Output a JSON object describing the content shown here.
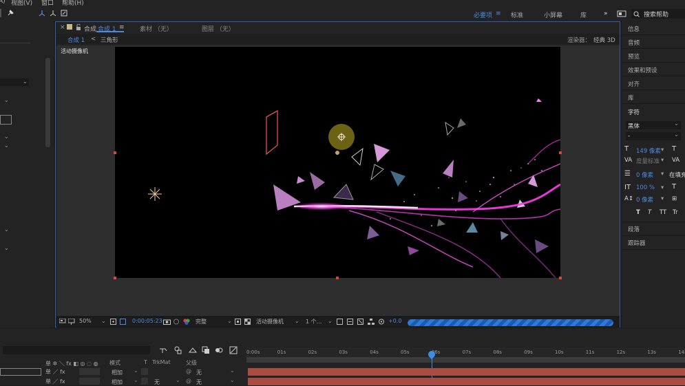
{
  "menubar": {
    "items": [
      "A)",
      "视图(V)",
      "窗口",
      "帮助(H)"
    ]
  },
  "workspaces": {
    "items": [
      "必要项",
      "标准",
      "小屏幕",
      "库"
    ],
    "active": "必要项",
    "overflow": "»",
    "search_placeholder": "搜索帮助"
  },
  "comp_panel": {
    "tab_title": "合成",
    "tab_name": "合成 1",
    "menu": "≡",
    "footage_tab": "素材 （无）",
    "layer_tab": "图层 （无）",
    "breadcrumb": [
      "合成 1",
      "三角形"
    ],
    "breadcrumb_sep": "<",
    "renderer": "渲染器：",
    "renderer_value": "经典 3D",
    "camera_label": "活动摄像机"
  },
  "viewer_footer": {
    "zoom": "50%",
    "timecode": "0:00:05:23",
    "resolution": "完整",
    "view": "活动摄像机",
    "view_count": "1 个...",
    "exposure": "+0.0",
    "render_progress": 0.98
  },
  "right_panel": {
    "items": [
      "信息",
      "音频",
      "预览",
      "效果和预设",
      "对齐",
      "库",
      "字符"
    ],
    "font": "黑体",
    "font_style": "-",
    "font_size": "149 像素",
    "tracking_label": "度量标准",
    "tracking": "0 像素",
    "leading": "在填充",
    "scale": "100 %",
    "baseline": "0 像素",
    "text_styles": [
      "T",
      "T",
      "TT",
      "Tr"
    ],
    "bottom_items": [
      "段落",
      "跟踪器"
    ]
  },
  "timeline": {
    "ruler_ticks": [
      "0:00s",
      "01s",
      "02s",
      "03s",
      "04s",
      "05s",
      "06s",
      "07s",
      "08s",
      "09s",
      "10s",
      "11s",
      "12s",
      "13s",
      "14s"
    ],
    "columns": [
      "模式",
      "T",
      "TrkMat",
      "父级"
    ],
    "layers": [
      {
        "mode": "相加",
        "trkmat": "",
        "parent": "无"
      },
      {
        "mode": "相加",
        "trkmat": "无",
        "parent": "无"
      }
    ]
  },
  "colors": {
    "accent": "#4d8ae0",
    "layer_bar": "#a84c44",
    "light_streak": "#ff3df0",
    "panel_border": "#2d5fb0"
  }
}
